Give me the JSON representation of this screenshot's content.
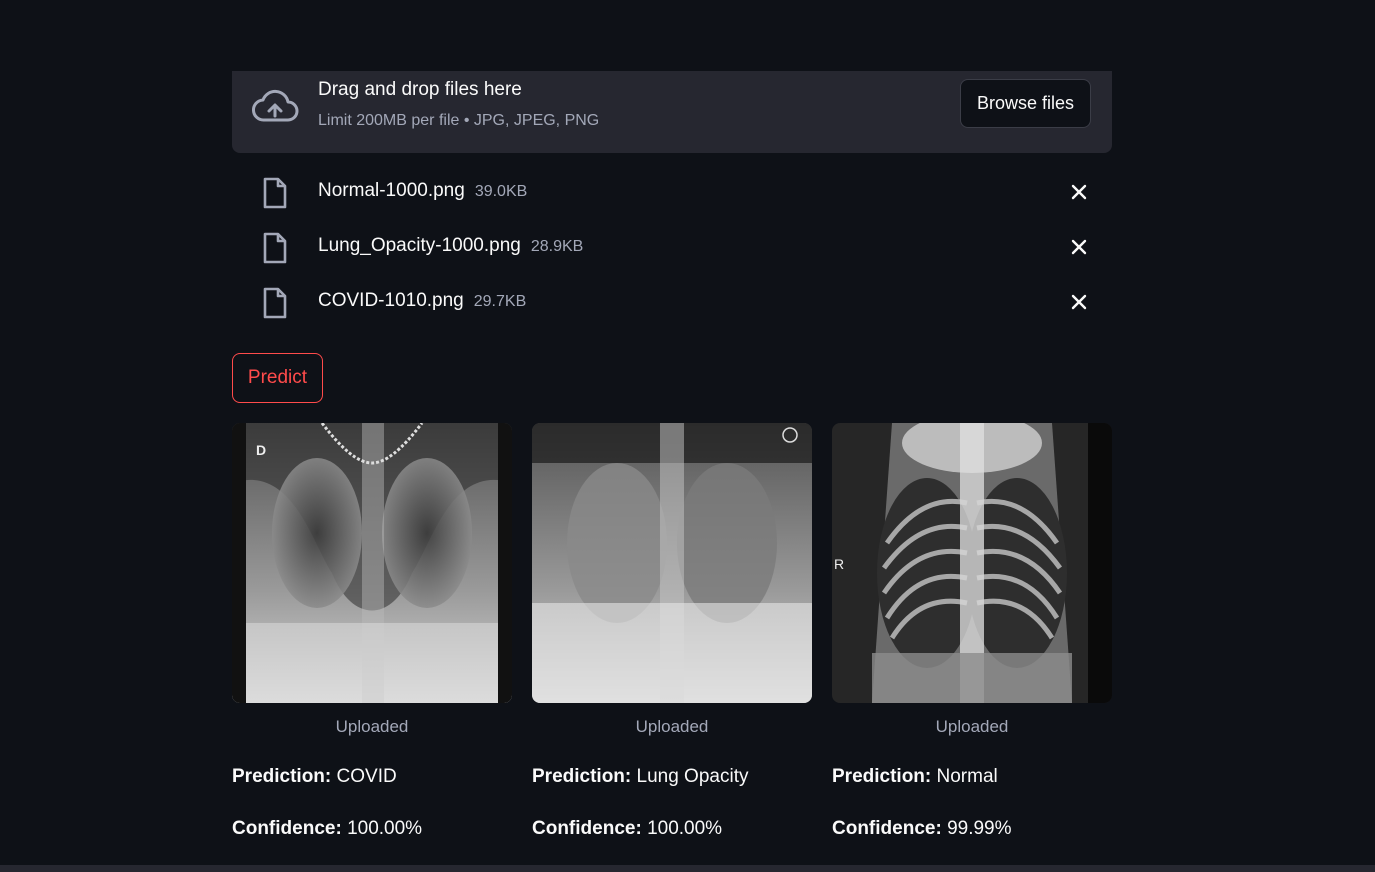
{
  "uploader": {
    "title": "Drag and drop files here",
    "limit": "Limit 200MB per file • JPG, JPEG, PNG",
    "browse_label": "Browse files",
    "icon": "cloud-upload-icon"
  },
  "files": [
    {
      "name": "Normal-1000.png",
      "size": "39.0KB"
    },
    {
      "name": "Lung_Opacity-1000.png",
      "size": "28.9KB"
    },
    {
      "name": "COVID-1010.png",
      "size": "29.7KB"
    }
  ],
  "predict_label": "Predict",
  "results": [
    {
      "caption": "Uploaded",
      "prediction_label": "Prediction:",
      "prediction": "COVID",
      "confidence_label": "Confidence:",
      "confidence": "100.00%",
      "marker": "D"
    },
    {
      "caption": "Uploaded",
      "prediction_label": "Prediction:",
      "prediction": "Lung Opacity",
      "confidence_label": "Confidence:",
      "confidence": "100.00%",
      "marker": ""
    },
    {
      "caption": "Uploaded",
      "prediction_label": "Prediction:",
      "prediction": "Normal",
      "confidence_label": "Confidence:",
      "confidence": "99.99%",
      "marker": "R"
    }
  ],
  "colors": {
    "background": "#0e1117",
    "panel": "#262730",
    "accent": "#ff4b4b",
    "muted": "#a3a8b8"
  }
}
